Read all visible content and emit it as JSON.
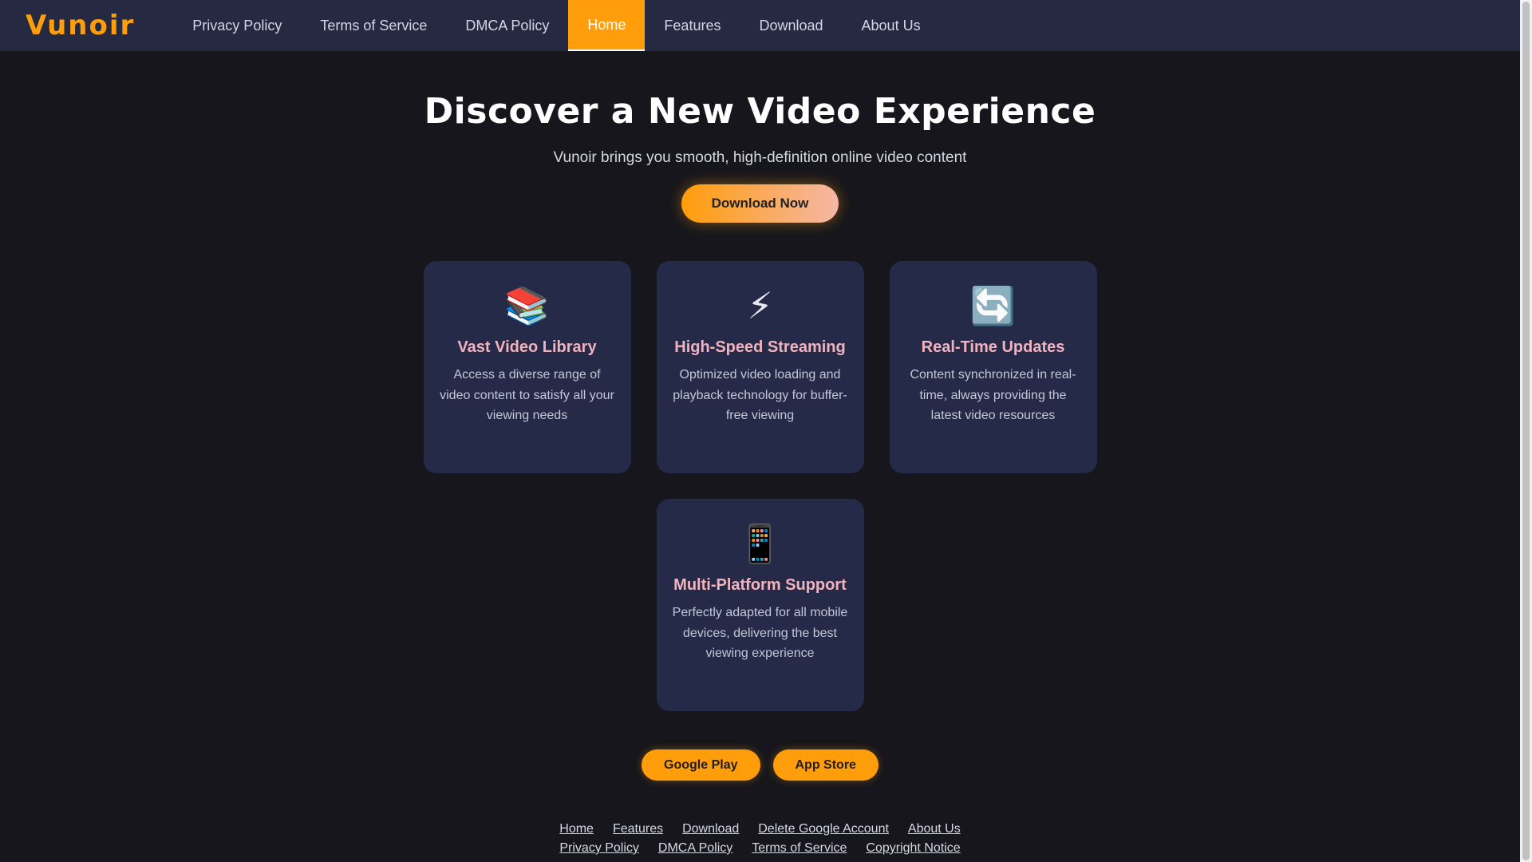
{
  "brand": {
    "name": "Vunoir",
    "accent": "#ff9d0a"
  },
  "nav": {
    "items": [
      {
        "label": "Privacy Policy"
      },
      {
        "label": "Terms of Service"
      },
      {
        "label": "DMCA Policy"
      },
      {
        "label": "Home",
        "active": true
      },
      {
        "label": "Features"
      },
      {
        "label": "Download"
      },
      {
        "label": "About Us"
      }
    ]
  },
  "hero": {
    "title": "Discover a New Video Experience",
    "subtitle": "Vunoir brings you smooth, high-definition online video content",
    "cta_label": "Download Now"
  },
  "features": [
    {
      "icon": "📚",
      "icon_name": "books-icon",
      "title": "Vast Video Library",
      "description": "Access a diverse range of video content to satisfy all your viewing needs"
    },
    {
      "icon": "⚡",
      "icon_name": "lightning-icon",
      "title": "High-Speed Streaming",
      "description": "Optimized video loading and playback technology for buffer-free viewing"
    },
    {
      "icon": "🔄",
      "icon_name": "refresh-icon",
      "title": "Real-Time Updates",
      "description": "Content synchronized in real-time, always providing the latest video resources"
    },
    {
      "icon": "📱",
      "icon_name": "phone-icon",
      "title": "Multi-Platform Support",
      "description": "Perfectly adapted for all mobile devices, delivering the best viewing experience"
    }
  ],
  "stores": {
    "google_play": "Google Play",
    "app_store": "App Store"
  },
  "footer": {
    "row1": [
      "Home",
      "Features",
      "Download",
      "Delete Google Account",
      "About Us"
    ],
    "row2": [
      "Privacy Policy",
      "DMCA Policy",
      "Terms of Service",
      "Copyright Notice"
    ]
  }
}
